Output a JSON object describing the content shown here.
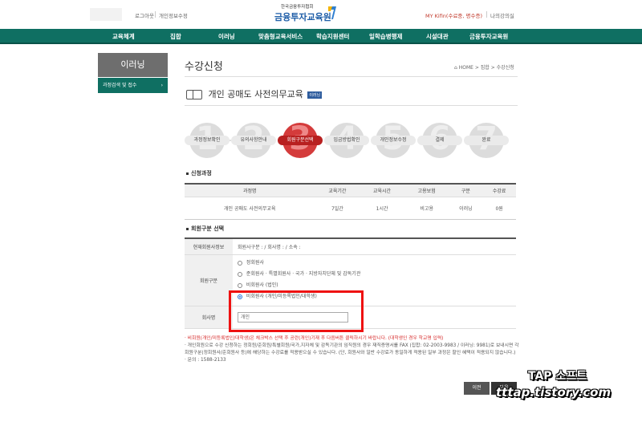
{
  "topbar": {
    "logout": "로그아웃",
    "edit_info": "개인정보수정",
    "my_label": "MY Kifin(수료중, 명수증)",
    "my_classroom": "나의강의실"
  },
  "logo": {
    "sub": "한국금융투자협회",
    "main": "금융투자교육원"
  },
  "nav": [
    "교육체계",
    "집합",
    "이러닝",
    "맞춤형교육서비스",
    "학습지원센터",
    "일학습병행제",
    "시설대관",
    "금융투자교육원"
  ],
  "sidebar": {
    "title": "이러닝",
    "sub_item": "과정검색 및 접수"
  },
  "page": {
    "title": "수강신청",
    "breadcrumb": "HOME > 집합 > 수강신청",
    "course_title": "개인 공매도 사전의무교육",
    "course_tag": "이러닝"
  },
  "steps": [
    {
      "num": "1",
      "label": "과정정보확인"
    },
    {
      "num": "2",
      "label": "유의사항안내"
    },
    {
      "num": "3",
      "label": "회원구분선택"
    },
    {
      "num": "4",
      "label": "입금방법확인"
    },
    {
      "num": "5",
      "label": "개인정보수정"
    },
    {
      "num": "6",
      "label": "결제"
    },
    {
      "num": "7",
      "label": "완료"
    }
  ],
  "course_section": {
    "title": "신청과정",
    "headers": [
      "과정명",
      "교육기간",
      "교육시간",
      "고용보험",
      "구분",
      "수강료"
    ],
    "row": [
      "개인 공매도 사전의무교육",
      "7일간",
      "1시간",
      "비고용",
      "이러닝",
      "0원"
    ]
  },
  "member_section": {
    "title": "회원구분 선택",
    "current_label": "현재회원사정보",
    "current_value": "회원사구분 : / 회사명 : / 소속 :",
    "type_label": "회원구분",
    "options": [
      "정회원사",
      "준회원사 · 특별회원사 · 국가 · 지방자치단체 및 감독기관",
      "비회원사 (법인)",
      "비회원사 (개인/미등록법인/대학생)"
    ],
    "company_label": "회사명",
    "company_value": "개인"
  },
  "notes": {
    "note1": "· 비회원(개인/미등록법인/대학생)은 체크박스 선택 후 공란(개인)기재 후 다음버튼 클릭하시기 바랍니다. (대학생인 경우 학교명 입력)",
    "note2": "· 개인회원으로 수강 신청하는 정회원/준회원/특별회원/국가,지자체 및 감독기관의 임직원의 경우 재직증명서를 FAX (집합: 02-2003-9983 / 이러닝: 9981)로 보내시면 각 회원구분(정회원사/준회원사 등)에 해당하는 수강료를 적용받으실 수 있습니다. (단, 회원사와 일반 수강료가 동일하게 적용된 일부 과정은 할인 혜택이 적용되지 않습니다.)",
    "note3": "· 문의 : 1588-2133"
  },
  "buttons": {
    "prev": "이전",
    "next": "다음"
  },
  "watermark": {
    "line1": "TAP 소프트",
    "line2": "tttap.tistory.com"
  },
  "colors": {
    "nav_green": "#0f6f62",
    "active_step": "#d43b3b",
    "highlight_red": "#ee1111",
    "logo_blue": "#1f5ea8"
  }
}
